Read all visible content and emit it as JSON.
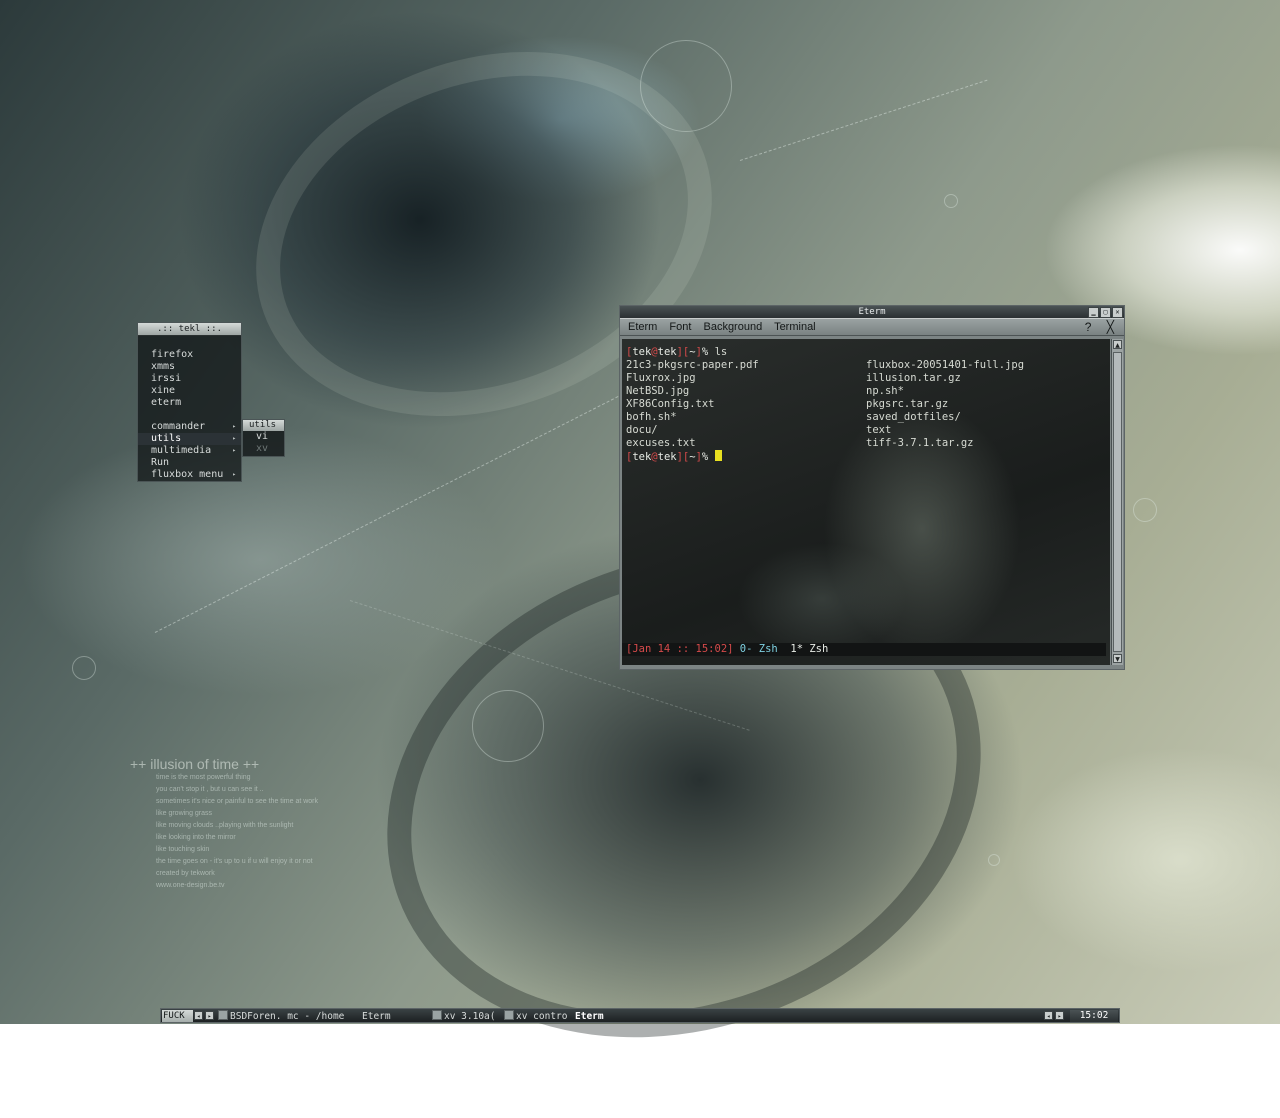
{
  "wallpaper": {
    "caption_title": "++ illusion of time ++",
    "caption_lines": [
      "time is the most powerful thing",
      "you can't stop it , but u can see it ..",
      "sometimes it's nice or painful to see the time at work",
      "like growing grass",
      "like moving clouds ..playing with the sunlight",
      "like looking into the mirror",
      "like touching skin",
      "the time goes on - it's up to u if u will enjoy it or not",
      "",
      "created by tekwork",
      "www.one-design.be.tv"
    ]
  },
  "root_menu": {
    "title": ".:: tekl ::.",
    "items": [
      {
        "label": "firefox"
      },
      {
        "label": "xmms"
      },
      {
        "label": "irssi"
      },
      {
        "label": "xine"
      },
      {
        "label": "eterm"
      }
    ],
    "submenus": [
      {
        "label": "commander",
        "arrow": "▸"
      },
      {
        "label": "utils",
        "arrow": "▸"
      },
      {
        "label": "multimedia",
        "arrow": "▸"
      },
      {
        "label": "Run",
        "arrow": ""
      },
      {
        "label": "fluxbox menu",
        "arrow": "▸"
      }
    ]
  },
  "utils_menu": {
    "title": "utils",
    "items": [
      {
        "label": "vi"
      },
      {
        "label": "xv"
      }
    ]
  },
  "eterm": {
    "title": "Eterm",
    "menus": [
      "Eterm",
      "Font",
      "Background",
      "Terminal"
    ],
    "help_glyph": "?",
    "close_glyph": "╳",
    "window_buttons": [
      "▁",
      "▢",
      "✕"
    ],
    "prompt": {
      "open": "[",
      "user": "tek",
      "at": "@",
      "host": "tek",
      "mid": "][",
      "dir": "~",
      "close": "]",
      "sign": "% "
    },
    "command": "ls",
    "listing": [
      [
        "21c3-pkgsrc-paper.pdf",
        "fluxbox-20051401-full.jpg"
      ],
      [
        "Fluxrox.jpg",
        "illusion.tar.gz"
      ],
      [
        "NetBSD.jpg",
        "np.sh*"
      ],
      [
        "XF86Config.txt",
        "pkgsrc.tar.gz"
      ],
      [
        "bofh.sh*",
        "saved_dotfiles/"
      ],
      [
        "docu/",
        "text"
      ],
      [
        "excuses.txt",
        "tiff-3.7.1.tar.gz"
      ]
    ],
    "status": {
      "date": "[Jan 14 :: 15:02]",
      "win0": " 0- Zsh",
      "win1": "  1* Zsh"
    },
    "scroll_up": "▲",
    "scroll_down": "▼"
  },
  "toolbar": {
    "workspace": "FUCK",
    "prev": "◂",
    "next": "▸",
    "tasks": [
      {
        "label": "BSDForen. mc - /home",
        "active": false
      },
      {
        "label": "Eterm",
        "active": false
      },
      {
        "label": "xv 3.10a(",
        "active": false
      },
      {
        "label": "xv contro",
        "active": false
      },
      {
        "label": "Eterm",
        "active": true
      }
    ],
    "win_prev": "◂",
    "win_next": "▸",
    "clock": "15:02"
  }
}
